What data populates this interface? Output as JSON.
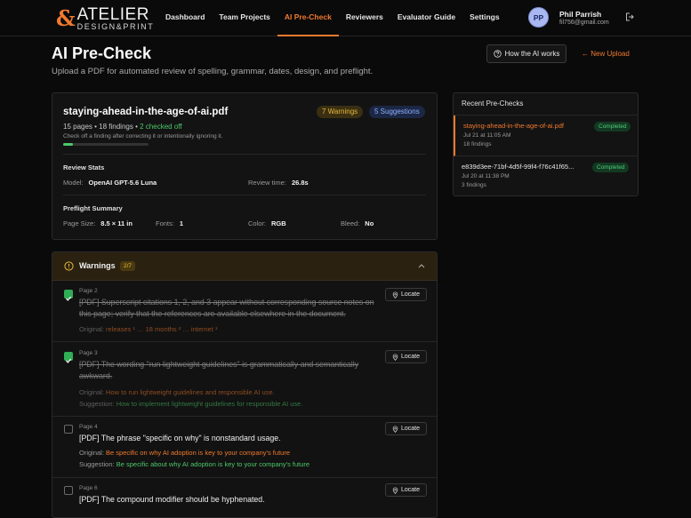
{
  "brand": {
    "line1": "ATELIER",
    "line2": "DESIGN&PRINT",
    "accent": "#f07a2e"
  },
  "nav": [
    {
      "label": "Dashboard",
      "active": false
    },
    {
      "label": "Team Projects",
      "active": false
    },
    {
      "label": "AI Pre-Check",
      "active": true
    },
    {
      "label": "Reviewers",
      "active": false
    },
    {
      "label": "Evaluator Guide",
      "active": false
    },
    {
      "label": "Settings",
      "active": false
    }
  ],
  "user": {
    "initials": "PP",
    "name": "Phil Parrish",
    "email": "fil756@gmail.com"
  },
  "page": {
    "title": "AI Pre-Check",
    "subtitle": "Upload a PDF for automated review of spelling, grammar, dates, design, and preflight.",
    "how_label": "How the AI works",
    "new_upload_label": "← New Upload"
  },
  "doc": {
    "filename": "staying-ahead-in-the-age-of-ai.pdf",
    "warnings_badge": "7 Warnings",
    "suggestions_badge": "5 Suggestions",
    "pages_findings": "15 pages • 18 findings •",
    "checked_off": "2 checked off",
    "hint": "Check off a finding after correcting it or intentionally ignoring it.",
    "progress_fraction": 0.11,
    "review_stats_label": "Review Stats",
    "model_label": "Model:",
    "model_value": "OpenAI GPT-5.6 Luna",
    "review_time_label": "Review time:",
    "review_time_value": "26.8s",
    "preflight_label": "Preflight Summary",
    "page_size_label": "Page Size:",
    "page_size_value": "8.5 × 11 in",
    "fonts_label": "Fonts:",
    "fonts_value": "1",
    "color_label": "Color:",
    "color_value": "RGB",
    "bleed_label": "Bleed:",
    "bleed_value": "No"
  },
  "recent": {
    "title": "Recent Pre-Checks",
    "items": [
      {
        "name": "staying-ahead-in-the-age-of-ai.pdf",
        "date": "Jul 21 at 11:05 AM",
        "findings": "18 findings",
        "status": "Completed"
      },
      {
        "name": "e839d3ee-71bf-4d5f-99f4-f76c41f65...",
        "date": "Jul 20 at 11:38 PM",
        "findings": "3 findings",
        "status": "Completed"
      }
    ]
  },
  "warnings": {
    "title": "Warnings",
    "count": "2/7",
    "original_label": "Original:",
    "suggestion_label": "Suggestion:",
    "locate_label": "Locate",
    "items": [
      {
        "page": "Page 2",
        "checked": true,
        "text": "[PDF] Superscript citations 1, 2, and 3 appear without corresponding source notes on this page; verify that the references are available elsewhere in the document.",
        "original": "releases ¹ … 18 months ² … internet ³",
        "suggestion": ""
      },
      {
        "page": "Page 3",
        "checked": true,
        "text": "[PDF] The wording \"run lightweight guidelines\" is grammatically and semantically awkward.",
        "original": "How to run lightweight guidelines and responsible AI use.",
        "suggestion": "How to implement lightweight guidelines for responsible AI use."
      },
      {
        "page": "Page 4",
        "checked": false,
        "text": "[PDF] The phrase \"specific on why\" is nonstandard usage.",
        "original": "Be specific on why AI adoption is key to your company's future",
        "suggestion": "Be specific about why AI adoption is key to your company's future"
      },
      {
        "page": "Page 6",
        "checked": false,
        "text": "[PDF] The compound modifier should be hyphenated.",
        "original": "",
        "suggestion": ""
      }
    ]
  }
}
